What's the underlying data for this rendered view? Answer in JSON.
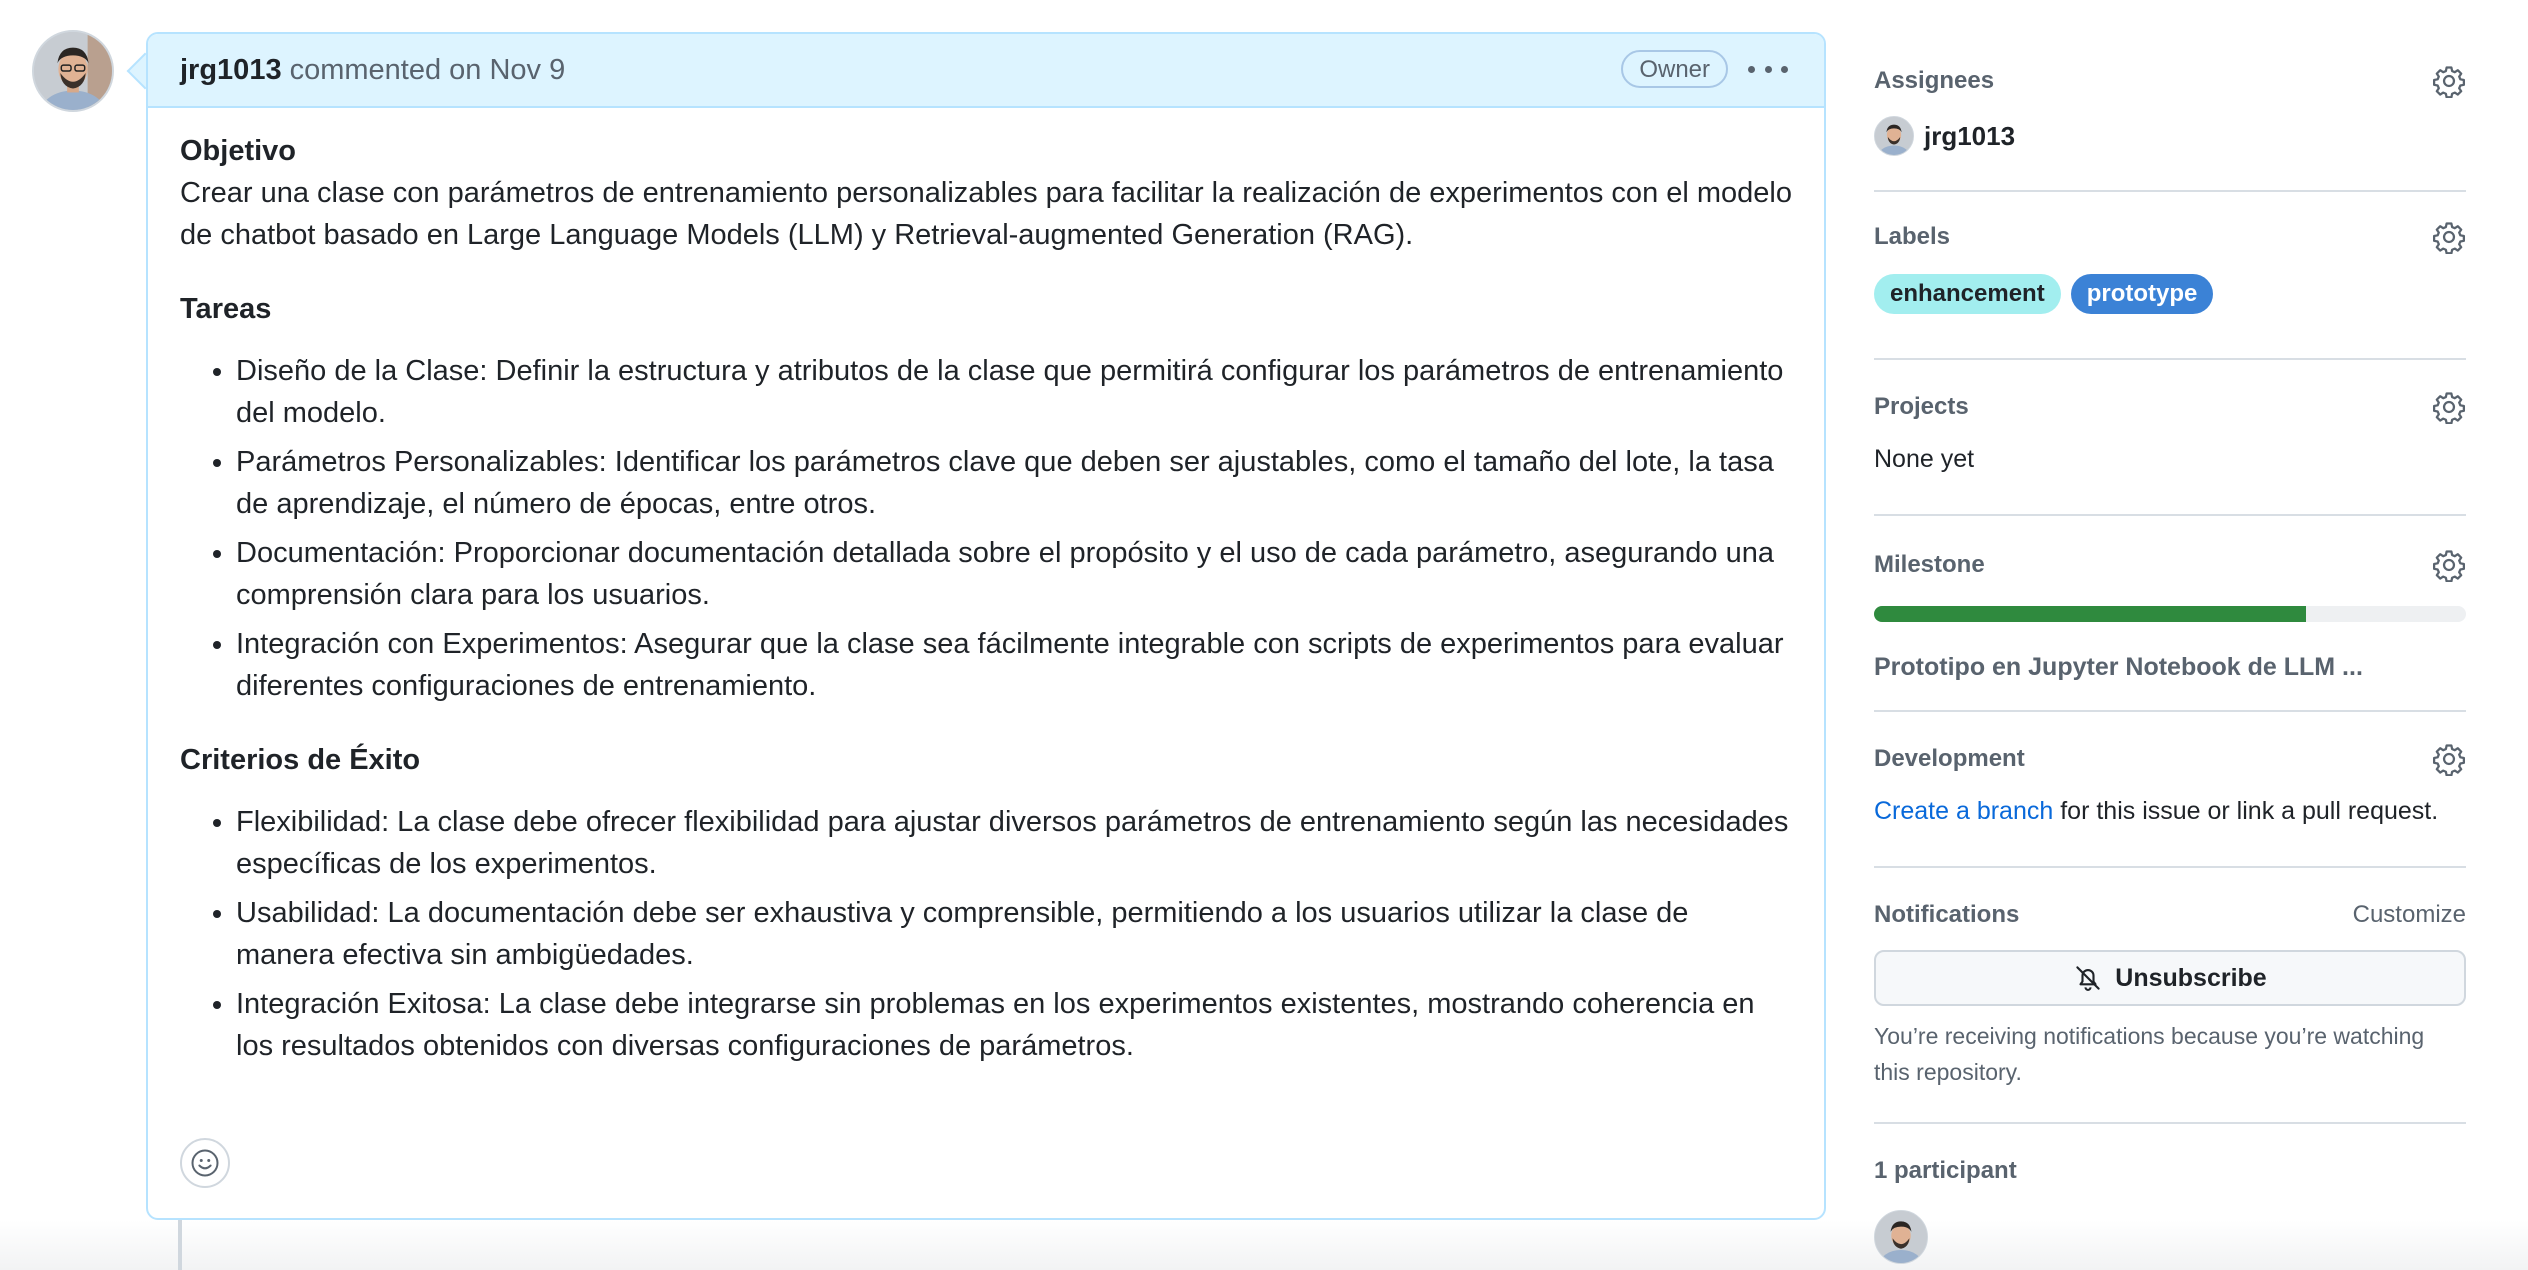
{
  "comment": {
    "author": "jrg1013",
    "meta": "commented on Nov 9",
    "badge": "Owner",
    "sections": {
      "objetivo_title": "Objetivo",
      "objetivo_text": "Crear una clase con parámetros de entrenamiento personalizables para facilitar la realización de experimentos con el modelo de chatbot basado en Large Language Models (LLM) y Retrieval-augmented Generation (RAG).",
      "tareas_title": "Tareas",
      "tareas": [
        "Diseño de la Clase: Definir la estructura y atributos de la clase que permitirá configurar los parámetros de entrenamiento del modelo.",
        "Parámetros Personalizables: Identificar los parámetros clave que deben ser ajustables, como el tamaño del lote, la tasa de aprendizaje, el número de épocas, entre otros.",
        "Documentación: Proporcionar documentación detallada sobre el propósito y el uso de cada parámetro, asegurando una comprensión clara para los usuarios.",
        "Integración con Experimentos: Asegurar que la clase sea fácilmente integrable con scripts de experimentos para evaluar diferentes configuraciones de entrenamiento."
      ],
      "criterios_title": "Criterios de Éxito",
      "criterios": [
        "Flexibilidad: La clase debe ofrecer flexibilidad para ajustar diversos parámetros de entrenamiento según las necesidades específicas de los experimentos.",
        "Usabilidad: La documentación debe ser exhaustiva y comprensible, permitiendo a los usuarios utilizar la clase de manera efectiva sin ambigüedades.",
        "Integración Exitosa: La clase debe integrarse sin problemas en los experimentos existentes, mostrando coherencia en los resultados obtenidos con diversas configuraciones de parámetros."
      ]
    },
    "icons": {
      "reaction": "smiley-icon",
      "menu": "kebab-horizontal-icon"
    }
  },
  "sidebar": {
    "assignees": {
      "title": "Assignees",
      "name": "jrg1013"
    },
    "labels": {
      "title": "Labels",
      "items": [
        {
          "name": "enhancement",
          "color": "#a2eeef"
        },
        {
          "name": "prototype",
          "color": "#3b82d6"
        }
      ]
    },
    "projects": {
      "title": "Projects",
      "value": "None yet"
    },
    "milestone": {
      "title": "Milestone",
      "progress_percent": 73,
      "name": "Prototipo en Jupyter Notebook de LLM ..."
    },
    "development": {
      "title": "Development",
      "link_text": "Create a branch",
      "rest_text": " for this issue or link a pull request."
    },
    "notifications": {
      "title": "Notifications",
      "customize": "Customize",
      "button": "Unsubscribe",
      "note": "You’re receiving notifications because you’re watching this repository."
    },
    "participants": {
      "title": "1 participant"
    }
  },
  "colors": {
    "accent_link": "#0969da",
    "header_bg": "#ddf4ff",
    "progress": "#2f8a3e"
  }
}
